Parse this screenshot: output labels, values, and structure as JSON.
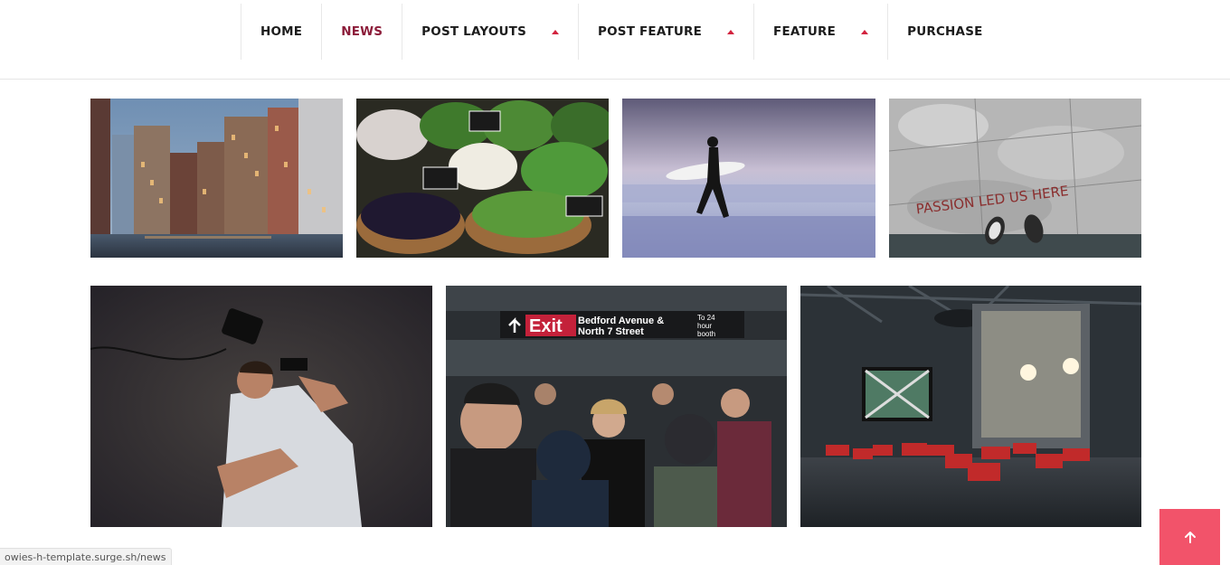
{
  "nav": {
    "items": [
      {
        "label": "HOME",
        "active": false,
        "dropdown": false
      },
      {
        "label": "NEWS",
        "active": true,
        "dropdown": false
      },
      {
        "label": "POST LAYOUTS",
        "active": false,
        "dropdown": true
      },
      {
        "label": "POST FEATURE",
        "active": false,
        "dropdown": true
      },
      {
        "label": "FEATURE",
        "active": false,
        "dropdown": true
      },
      {
        "label": "PURCHASE",
        "active": false,
        "dropdown": false
      }
    ],
    "active_color": "#8c1d3a",
    "caret_color": "#d2233e"
  },
  "gallery": {
    "photos": [
      {
        "subject": "canal-city-night"
      },
      {
        "subject": "vegetable-market"
      },
      {
        "subject": "surfer-beach"
      },
      {
        "subject": "passion-led-us-here",
        "caption": "PASSION LED US HERE"
      },
      {
        "subject": "man-with-camera"
      },
      {
        "subject": "subway-crowd",
        "sign": {
          "exit": "Exit",
          "line1": "Bedford Avenue &",
          "line2": "North 7 Street",
          "side1": "To 24",
          "side2": "hour",
          "side3": "booth"
        }
      },
      {
        "subject": "warehouse-lounge"
      }
    ]
  },
  "status_bar": {
    "url": "owies-h-template.surge.sh/news"
  },
  "back_to_top": {
    "icon": "arrow-up-icon",
    "color": "#f2536a"
  }
}
